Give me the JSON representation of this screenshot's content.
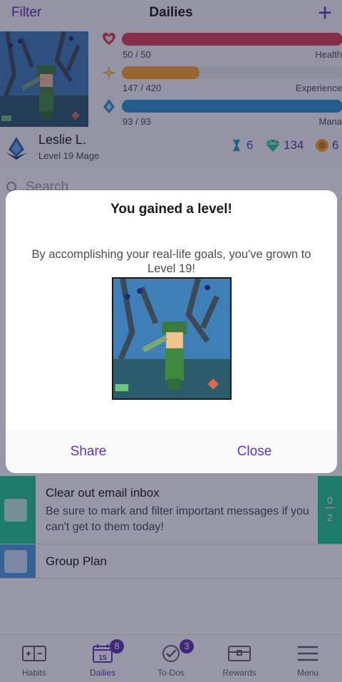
{
  "nav": {
    "filter_label": "Filter",
    "title": "Dailies",
    "add_icon": "plus-icon"
  },
  "stats": {
    "health": {
      "current": "50 / 50",
      "label": "Health",
      "fraction": 1.0,
      "color": "#de3f51",
      "icon": "heart-icon"
    },
    "experience": {
      "current": "147 / 420",
      "label": "Experience",
      "fraction": 0.35,
      "color": "#ffa624",
      "icon": "star-icon"
    },
    "mana": {
      "current": "93 / 93",
      "label": "Mana",
      "fraction": 1.0,
      "color": "#2995cd",
      "icon": "mana-drop-icon"
    }
  },
  "user": {
    "name": "Leslie L.",
    "level_text": "Level 19 Mage",
    "class_icon": "mage-class-icon",
    "hourglasses": "6",
    "gems": "134",
    "gold": "6"
  },
  "search": {
    "placeholder": "Search"
  },
  "tasks": [
    {
      "title": "Clear out email inbox",
      "notes": "Be sure to mark and filter important messages if you can't get to them today!",
      "streak_top": "0",
      "streak_bottom": "2"
    },
    {
      "title": "Group Plan"
    }
  ],
  "tabs": [
    {
      "label": "Habits",
      "icon": "habits-icon"
    },
    {
      "label": "Dailies",
      "icon": "calendar-icon",
      "badge": "8",
      "day": "15"
    },
    {
      "label": "To-Dos",
      "icon": "checkmark-icon",
      "badge": "3"
    },
    {
      "label": "Rewards",
      "icon": "treasure-chest-icon"
    },
    {
      "label": "Menu",
      "icon": "hamburger-icon"
    }
  ],
  "modal": {
    "title": "You gained a level!",
    "text": "By accomplishing your real-life goals, you've grown to Level 19!",
    "share_label": "Share",
    "close_label": "Close"
  },
  "colors": {
    "brand": "#6133b4",
    "streak": "#24cc8f",
    "overlay": "#1a183c"
  }
}
